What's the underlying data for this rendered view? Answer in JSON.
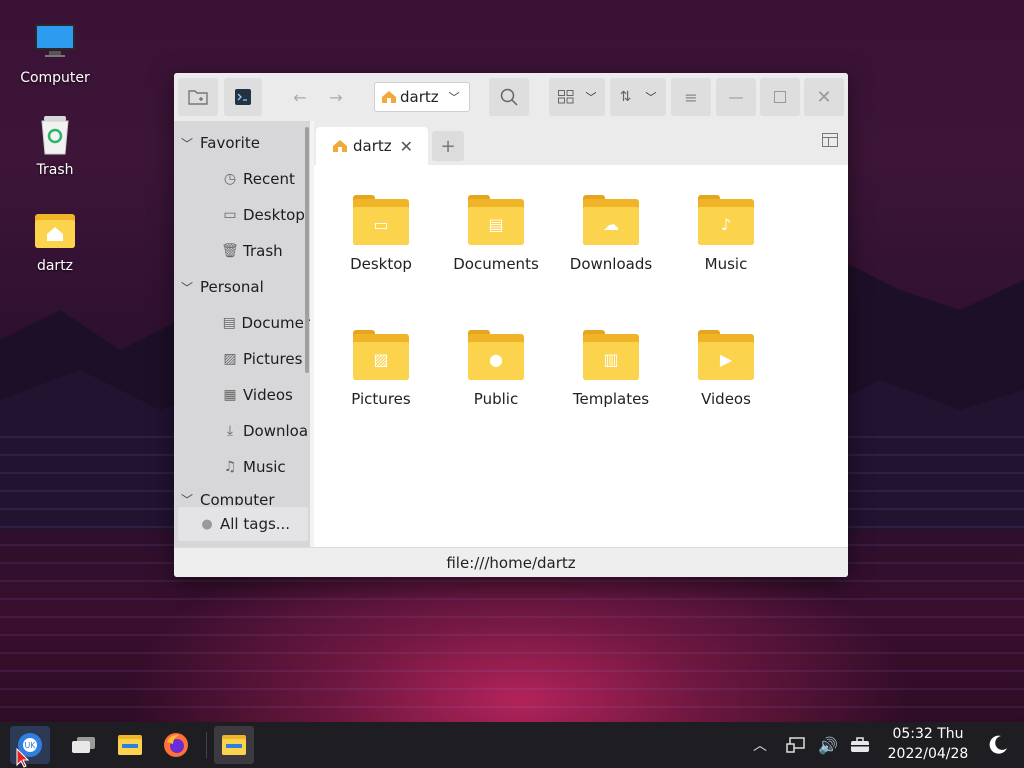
{
  "desktop": {
    "icons": [
      {
        "label": "Computer"
      },
      {
        "label": "Trash"
      },
      {
        "label": "dartz"
      }
    ]
  },
  "window": {
    "location": "dartz",
    "tab": "dartz",
    "tab_add": "+",
    "sidebar": {
      "groups": [
        {
          "label": "Favorite"
        },
        {
          "label": "Personal"
        },
        {
          "label": "Computer"
        }
      ],
      "items": [
        {
          "label": "Recent",
          "icon": "clock-icon"
        },
        {
          "label": "Desktop",
          "icon": "monitor-icon"
        },
        {
          "label": "Trash",
          "icon": "trash-icon"
        },
        {
          "label": "Documer",
          "icon": "document-icon"
        },
        {
          "label": "Pictures",
          "icon": "image-icon"
        },
        {
          "label": "Videos",
          "icon": "film-icon"
        },
        {
          "label": "Downloa",
          "icon": "download-icon"
        },
        {
          "label": "Music",
          "icon": "music-icon"
        }
      ],
      "all_tags": "All tags..."
    },
    "folders": [
      {
        "label": "Desktop",
        "icon": "monitor-icon"
      },
      {
        "label": "Documents",
        "icon": "document-icon"
      },
      {
        "label": "Downloads",
        "icon": "cloud-download-icon"
      },
      {
        "label": "Music",
        "icon": "music-icon"
      },
      {
        "label": "Pictures",
        "icon": "image-icon"
      },
      {
        "label": "Public",
        "icon": "person-icon"
      },
      {
        "label": "Templates",
        "icon": "template-icon"
      },
      {
        "label": "Videos",
        "icon": "play-icon"
      }
    ],
    "status": "file:///home/dartz"
  },
  "taskbar": {
    "time": "05:32 Thu",
    "date": "2022/04/28"
  },
  "colors": {
    "folder_front": "#fcd34d",
    "folder_back": "#f0b429",
    "taskbar": "#1e1e22"
  }
}
